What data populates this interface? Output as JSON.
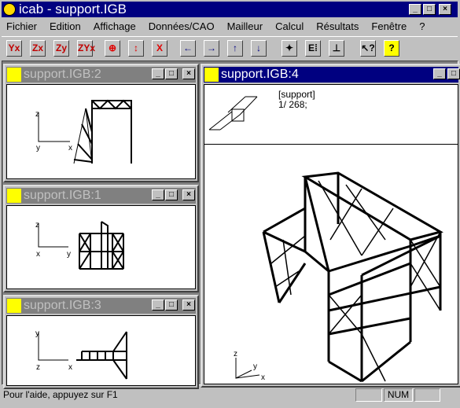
{
  "window": {
    "title": "icab - support.IGB",
    "controls": [
      "_",
      "□",
      "×"
    ]
  },
  "menu": [
    "Fichier",
    "Edition",
    "Affichage",
    "Données/CAO",
    "Mailleur",
    "Calcul",
    "Résultats",
    "Fenêtre",
    "?"
  ],
  "toolbar": [
    {
      "icon": "view-yx-icon",
      "label": "Yx"
    },
    {
      "icon": "view-zx-icon",
      "label": "Zx"
    },
    {
      "icon": "view-zy-icon",
      "label": "Zy"
    },
    {
      "icon": "view-zyx-icon",
      "label": "ZYx"
    },
    {
      "icon": "zoom-center-icon",
      "label": "⊕"
    },
    {
      "icon": "zoom-vertical-icon",
      "label": "↕"
    },
    {
      "icon": "zoom-fit-icon",
      "label": "X"
    },
    {
      "icon": "arrow-left-icon",
      "label": "←"
    },
    {
      "icon": "arrow-right-icon",
      "label": "→"
    },
    {
      "icon": "arrow-up-icon",
      "label": "↑"
    },
    {
      "icon": "arrow-down-icon",
      "label": "↓"
    },
    {
      "icon": "node-icon",
      "label": "✦"
    },
    {
      "icon": "element-icon",
      "label": "E⁞"
    },
    {
      "icon": "support-icon",
      "label": "⊥"
    },
    {
      "icon": "context-help-icon",
      "label": "↖?"
    },
    {
      "icon": "help-icon",
      "label": "?"
    }
  ],
  "children": [
    {
      "title": "support.IGB:2",
      "axes": [
        "z",
        "y",
        "x"
      ]
    },
    {
      "title": "support.IGB:1",
      "axes": [
        "z",
        "x",
        "y"
      ]
    },
    {
      "title": "support.IGB:3",
      "axes": [
        "y",
        "z",
        "x"
      ]
    },
    {
      "title": "support.IGB:4",
      "info": [
        "[support]",
        "1/ 268;"
      ],
      "axes": [
        "z",
        "y",
        "x"
      ]
    }
  ],
  "status": {
    "help": "Pour l'aide, appuyez sur F1",
    "num": "NUM"
  }
}
